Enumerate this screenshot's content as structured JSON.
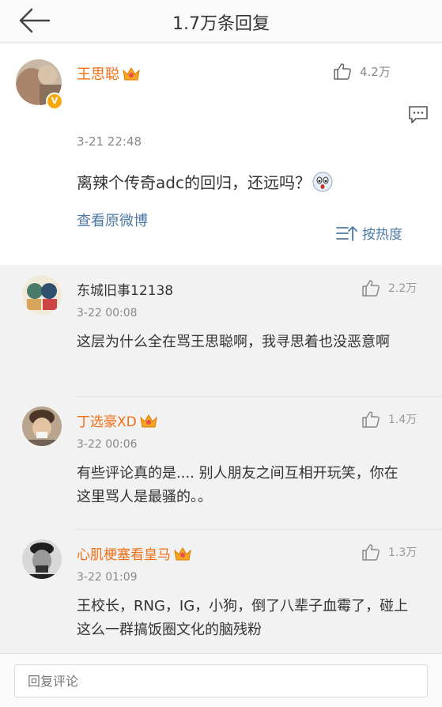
{
  "header": {
    "title": "1.7万条回复"
  },
  "post": {
    "author": "王思聪",
    "time": "3-21 22:48",
    "likes": "4.2万",
    "content": "离辣个传奇adc的回归，还远吗？",
    "view_original": "查看原微博"
  },
  "sort": {
    "label": "按热度"
  },
  "comments": [
    {
      "name": "东城旧事12138",
      "vip": false,
      "time": "3-22 00:08",
      "likes": "2.2万",
      "text": "这层为什么全在骂王思聪啊，我寻思着也没恶意啊"
    },
    {
      "name": "丁选豪XD",
      "vip": true,
      "time": "3-22 00:06",
      "likes": "1.4万",
      "text": "有些评论真的是.... 别人朋友之间互相开玩笑，你在这里骂人是最骚的。。"
    },
    {
      "name": "心肌梗塞看皇马",
      "vip": true,
      "time": "3-22 01:09",
      "likes": "1.3万",
      "text": "王校长，RNG，IG，小狗，倒了八辈子血霉了，碰上这么一群搞饭圈文化的脑残粉"
    }
  ],
  "reply": {
    "placeholder": "回复评论"
  },
  "colors": {
    "vip_name": "#f26e14",
    "link": "#4e79a5",
    "badge": "#f7a90b"
  }
}
